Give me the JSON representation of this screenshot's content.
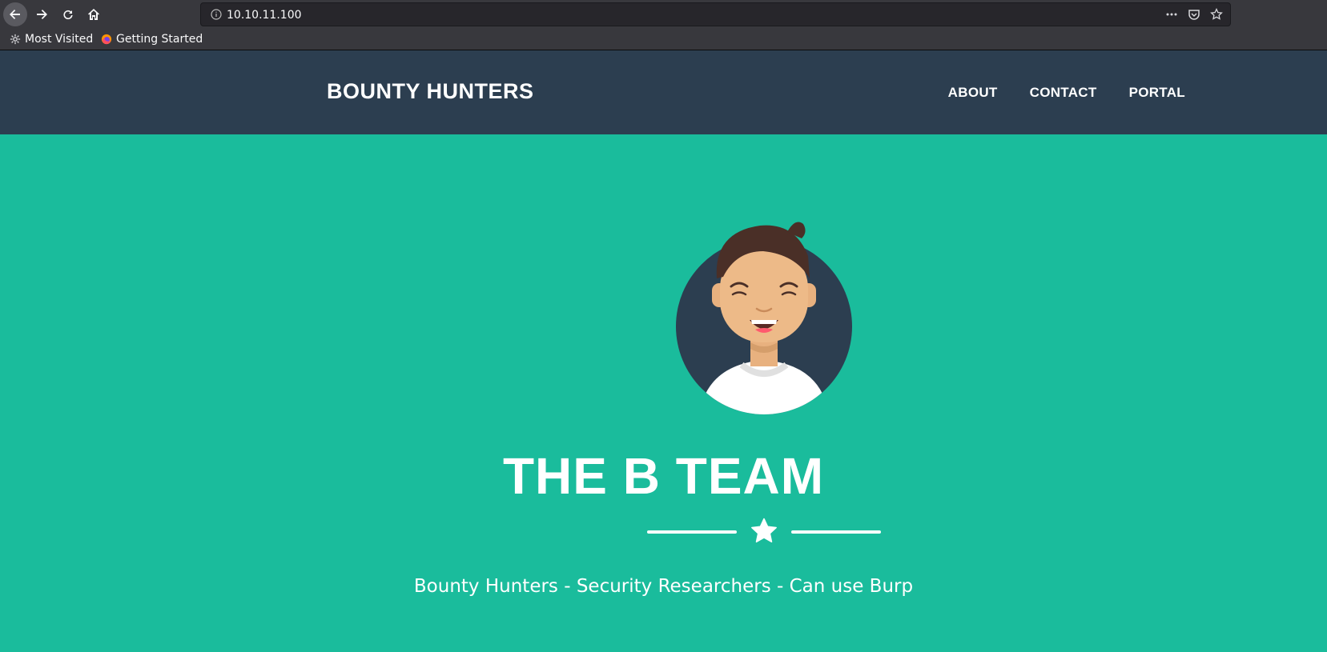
{
  "browser": {
    "url": "10.10.11.100",
    "bookmarks": [
      {
        "label": "Most Visited",
        "icon": "gear-icon"
      },
      {
        "label": "Getting Started",
        "icon": "firefox-icon"
      }
    ]
  },
  "site": {
    "brand": "BOUNTY HUNTERS",
    "menu": [
      "ABOUT",
      "CONTACT",
      "PORTAL"
    ]
  },
  "hero": {
    "title": "THE B TEAM",
    "subtitle": "Bounty Hunters - Security Researchers - Can use Burp",
    "avatar_icon": "smiling-man-avatar",
    "divider_icon": "star-icon"
  },
  "colors": {
    "hero_bg": "#1abc9c",
    "nav_bg": "#2c3e50",
    "text": "#ffffff"
  }
}
